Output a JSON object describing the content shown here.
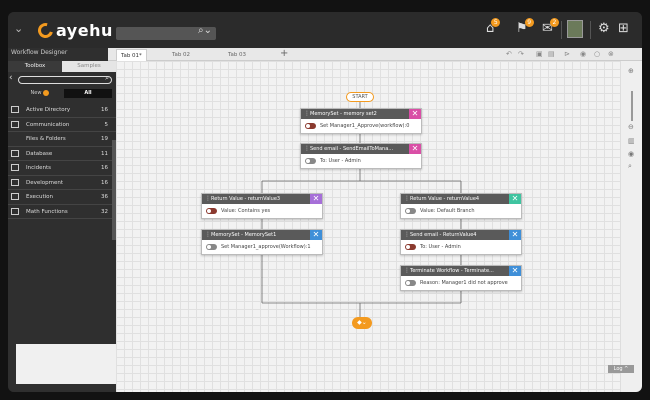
{
  "brand": {
    "name": "ayehu",
    "accent": "#f39a1f"
  },
  "topbar": {
    "search_icon": "search-icon",
    "badges": [
      "5",
      "9",
      "2"
    ]
  },
  "sidebar": {
    "title": "Workflow Designer",
    "tabs": [
      "Toolbox",
      "Samples"
    ],
    "filters": {
      "new": "New",
      "all": "All"
    },
    "items": [
      {
        "label": "Active Directory",
        "count": "16"
      },
      {
        "label": "Communication",
        "count": "5"
      },
      {
        "label": "Files & Folders",
        "count": "19"
      },
      {
        "label": "Database",
        "count": "11"
      },
      {
        "label": "Incidents",
        "count": "16"
      },
      {
        "label": "Development",
        "count": "16"
      },
      {
        "label": "Execution",
        "count": "36"
      },
      {
        "label": "Math Functions",
        "count": "32"
      }
    ]
  },
  "tabs": [
    {
      "label": "Tab 01*"
    },
    {
      "label": "Tab 02"
    },
    {
      "label": "Tab 03"
    }
  ],
  "canvas": {
    "start_label": "START",
    "nodes": [
      {
        "title": "MemorySet - memory set2",
        "text": "Set Manager1_Approve(workflow):0",
        "toggle_on": true,
        "x_color": "#d94fa6"
      },
      {
        "title": "Send email - SendEmailToMana...",
        "text": "To: User - Admin",
        "toggle_on": false,
        "x_color": "#d94fa6"
      },
      {
        "title": "Return Value - returnValue3",
        "text": "Value: Contains yes",
        "toggle_on": true,
        "x_color": "#a66fd8"
      },
      {
        "title": "MemorySet - MemorySet1",
        "text": "Set Manager1_approve(Workflow):1",
        "toggle_on": false,
        "x_color": "#3f8fd8"
      },
      {
        "title": "Return Value - returnValue4",
        "text": "Value: Default Branch",
        "toggle_on": false,
        "x_color": "#3fc4a0"
      },
      {
        "title": "Send email - ReturnValue4",
        "text": "To: User - Admin",
        "toggle_on": true,
        "x_color": "#3f8fd8"
      },
      {
        "title": "Terminate Workflow - Terminate...",
        "text": "Reason: Manager1 did not approve",
        "toggle_on": false,
        "x_color": "#3f8fd8"
      }
    ]
  },
  "footer": {
    "log_label": "Log ^"
  }
}
